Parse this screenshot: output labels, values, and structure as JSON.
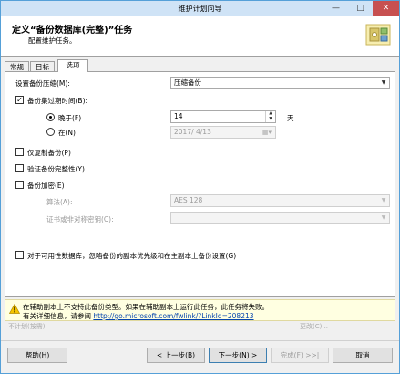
{
  "window": {
    "title": "维护计划向导",
    "minimize_glyph": "—",
    "maximize_glyph": "□",
    "close_glyph": "✕"
  },
  "header": {
    "title": "定义“备份数据库(完整)”任务",
    "subtitle": "配置维护任务。"
  },
  "tabs": [
    {
      "label": "常规",
      "active": false
    },
    {
      "label": "目标",
      "active": false
    },
    {
      "label": "选项",
      "active": true
    }
  ],
  "options": {
    "compression_label": "设置备份压缩(M):",
    "compression_value": "压缩备份",
    "expire_label": "备份集过期时间(B):",
    "expire_checked": true,
    "after_label": "晚于(F)",
    "after_value": "14",
    "after_unit": "天",
    "on_label": "在(N)",
    "on_value": "2017/ 4/13",
    "copy_only_label": "仅复制备份(P)",
    "verify_label": "验证备份完整性(Y)",
    "encrypt_label": "备份加密(E)",
    "algorithm_label": "算法(A):",
    "algorithm_value": "AES 128",
    "cert_label": "证书或非对称密钥(C):",
    "cert_value": "",
    "ag_label": "对于可用性数据库，忽略备份的副本优先级和在主副本上备份设置(G)"
  },
  "warning": {
    "line1": "在辅助副本上不支持此备份类型。如果在辅助副本上运行此任务，此任务将失败。",
    "line2_prefix": "有关详细信息，请参阅",
    "link": "http://go.microsoft.com/fwlink/?LinkId=208213"
  },
  "underlying": {
    "left_text": "不计划(按需)",
    "right_text": "更改(C)..."
  },
  "footer": {
    "help_label": "帮助(H)",
    "back_label": "< 上一步(B)",
    "next_label": "下一步(N) >",
    "finish_label": "完成(F) >>|",
    "cancel_label": "取消"
  },
  "colors": {
    "titlebar": "#cfe3f6",
    "close_button": "#c75050",
    "warning_background": "#ffffe1",
    "link": "#0645ad"
  },
  "icons": {
    "header": "maintenance-wizard-icon",
    "warning": "warning-icon",
    "dropdown": "chevron-down-icon",
    "spinner": "spin-up-down-icon",
    "calendar": "calendar-dropdown-icon"
  }
}
